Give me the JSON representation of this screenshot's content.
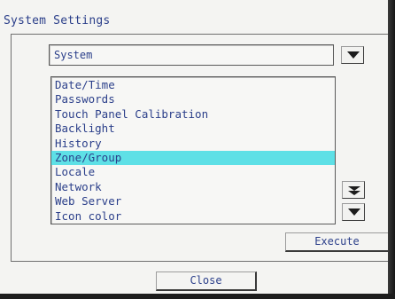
{
  "window": {
    "title": "System Settings"
  },
  "category_select": {
    "value": "System",
    "icon": "chevron-down-icon"
  },
  "settings_list": {
    "items": [
      "Date/Time",
      "Passwords",
      "Touch Panel Calibration",
      "Backlight",
      "History",
      "Zone/Group",
      "Locale",
      "Network",
      "Web Server",
      "Icon color"
    ],
    "selected": "Zone/Group",
    "selected_color": "#5ee0e6",
    "scroll_icons": [
      "double-chevron-down-icon",
      "chevron-down-icon"
    ]
  },
  "buttons": {
    "execute": "Execute",
    "close": "Close"
  },
  "colors": {
    "text": "#2b3f8a",
    "background": "#f4f4f2",
    "highlight": "#5ee0e6"
  }
}
